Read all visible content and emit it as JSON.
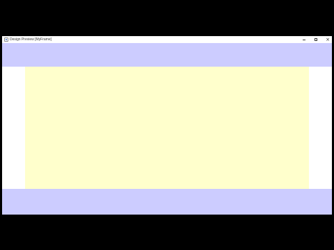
{
  "window": {
    "title": "Design Preview [MyFrame]",
    "controls": {
      "minimize_icon": "minimize-icon",
      "maximize_icon": "maximize-icon",
      "close_symbol": "×"
    }
  },
  "colors": {
    "north_panel": "#ccccff",
    "south_panel": "#ccccff",
    "center_panel": "#ffffcc",
    "window_background": "#ffffff"
  }
}
